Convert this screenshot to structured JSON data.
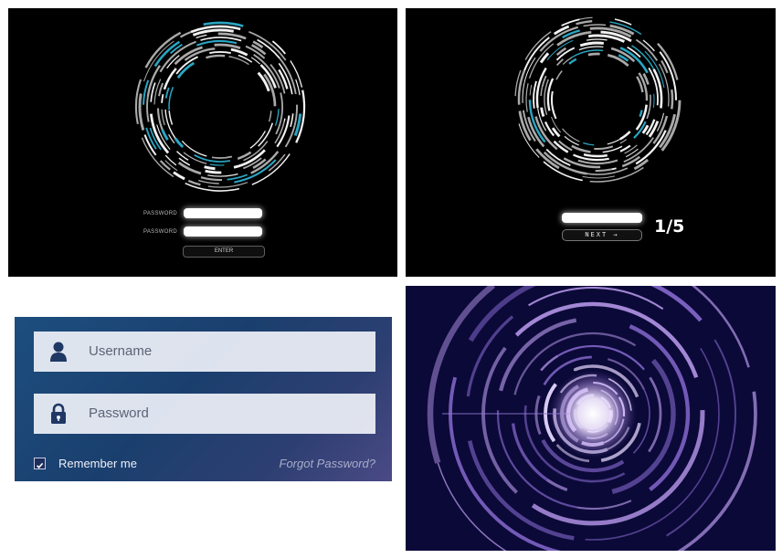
{
  "panel1": {
    "password_label_1": "PASSWORD",
    "password_label_2": "PASSWORD",
    "enter_label": "ENTER"
  },
  "panel2": {
    "next_label": "NEXT →",
    "counter": "1/5"
  },
  "panel3": {
    "username_placeholder": "Username",
    "password_placeholder": "Password",
    "remember_label": "Remember me",
    "remember_checked": true,
    "forgot_label": "Forgot Password?"
  },
  "icons": {
    "panel3_username": "user-icon",
    "panel3_password": "lock-icon",
    "panel3_checkbox": "check-icon"
  },
  "colors": {
    "black_bg": "#000000",
    "teal_accent": "#2aa6c4",
    "login_gradient_start": "#1d4e7e",
    "login_gradient_end": "#4b4a86",
    "tunnel_bg": "#0b0938",
    "tunnel_ring": "#a58ad8",
    "tunnel_glow": "#ffffff"
  }
}
